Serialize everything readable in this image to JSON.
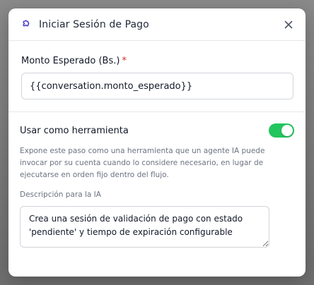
{
  "dialog": {
    "title": "Iniciar Sesión de Pago",
    "header_icon": "puzzle-icon",
    "close_icon": "close-icon"
  },
  "amount_field": {
    "label": "Monto Esperado (Bs.)",
    "required_marker": "*",
    "value": "{{conversation.monto_esperado}}"
  },
  "tool_section": {
    "label": "Usar como herramienta",
    "toggle_on": true,
    "toggle_color": "#22c55e",
    "description": "Expone este paso como una herramienta que un agente IA puede invocar por su cuenta cuando lo considere necesario, en lugar de ejecutarse en orden fijo dentro del flujo.",
    "ia_description_label": "Descripción para la IA",
    "ia_description_value": "Crea una sesión de validación de pago con estado 'pendiente' y tiempo de expiración configurable"
  }
}
